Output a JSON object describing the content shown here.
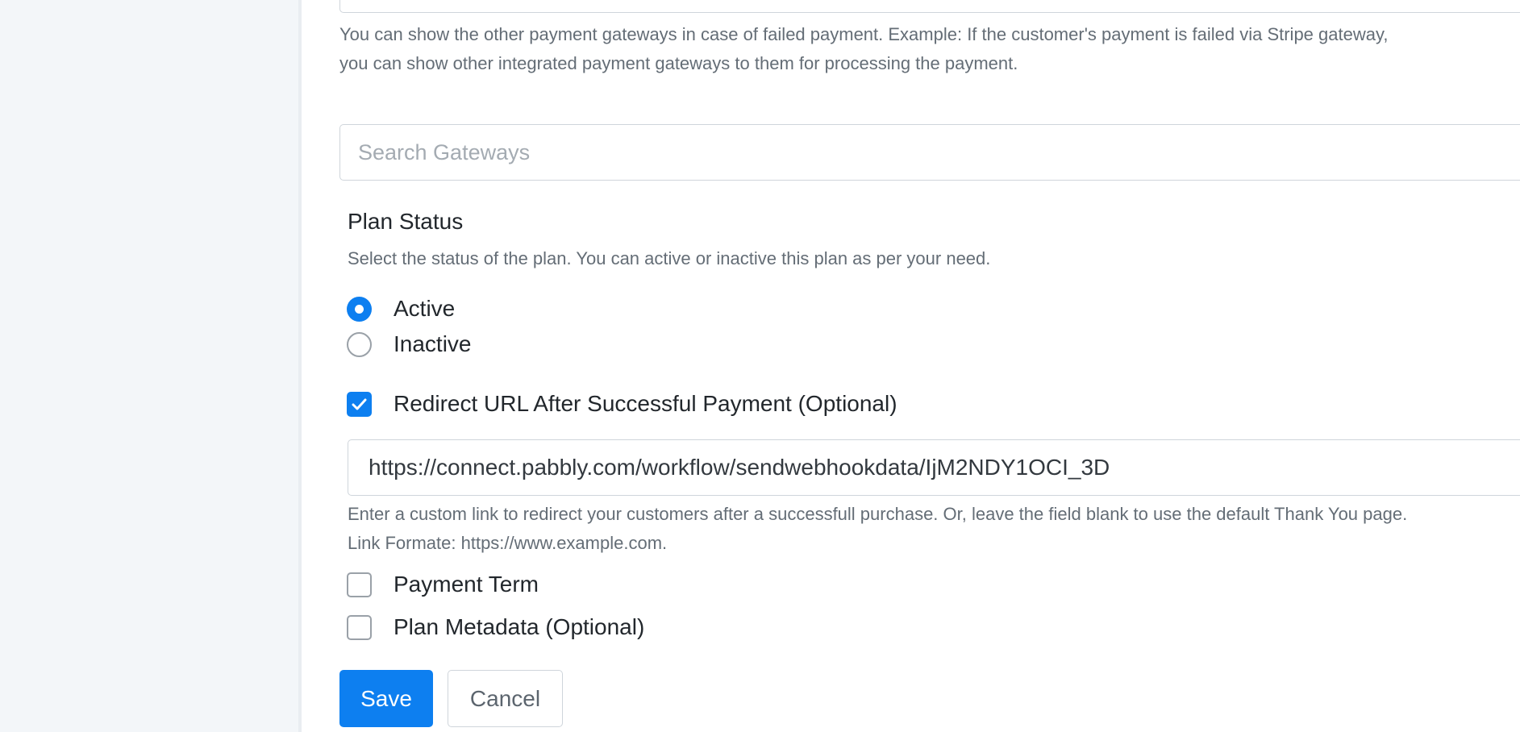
{
  "gateways": {
    "help_line1": "You can show the other payment gateways in case of failed payment. Example: If the customer's payment is failed via Stripe gateway,",
    "help_line2": "you can show other integrated payment gateways to them for processing the payment.",
    "search_placeholder": "Search Gateways"
  },
  "plan_status": {
    "title": "Plan Status",
    "description": "Select the status of the plan. You can active or inactive this plan as per your need.",
    "options": [
      {
        "label": "Active",
        "checked": true
      },
      {
        "label": "Inactive",
        "checked": false
      }
    ]
  },
  "redirect": {
    "label": "Redirect URL After Successful Payment (Optional)",
    "checked": true,
    "url_value": "https://connect.pabbly.com/workflow/sendwebhookdata/IjM2NDY1OCI_3D",
    "help_line1": "Enter a custom link to redirect your customers after a successfull purchase. Or, leave the field blank to use the default Thank You page.",
    "help_line2": "Link Formate: https://www.example.com."
  },
  "extras": [
    {
      "label": "Payment Term",
      "checked": false
    },
    {
      "label": "Plan Metadata (Optional)",
      "checked": false
    }
  ],
  "actions": {
    "save_label": "Save",
    "cancel_label": "Cancel"
  },
  "colors": {
    "accent": "#0d7ff0",
    "background": "#f3f6f9",
    "panel": "#ffffff",
    "muted_text": "#646d76"
  }
}
